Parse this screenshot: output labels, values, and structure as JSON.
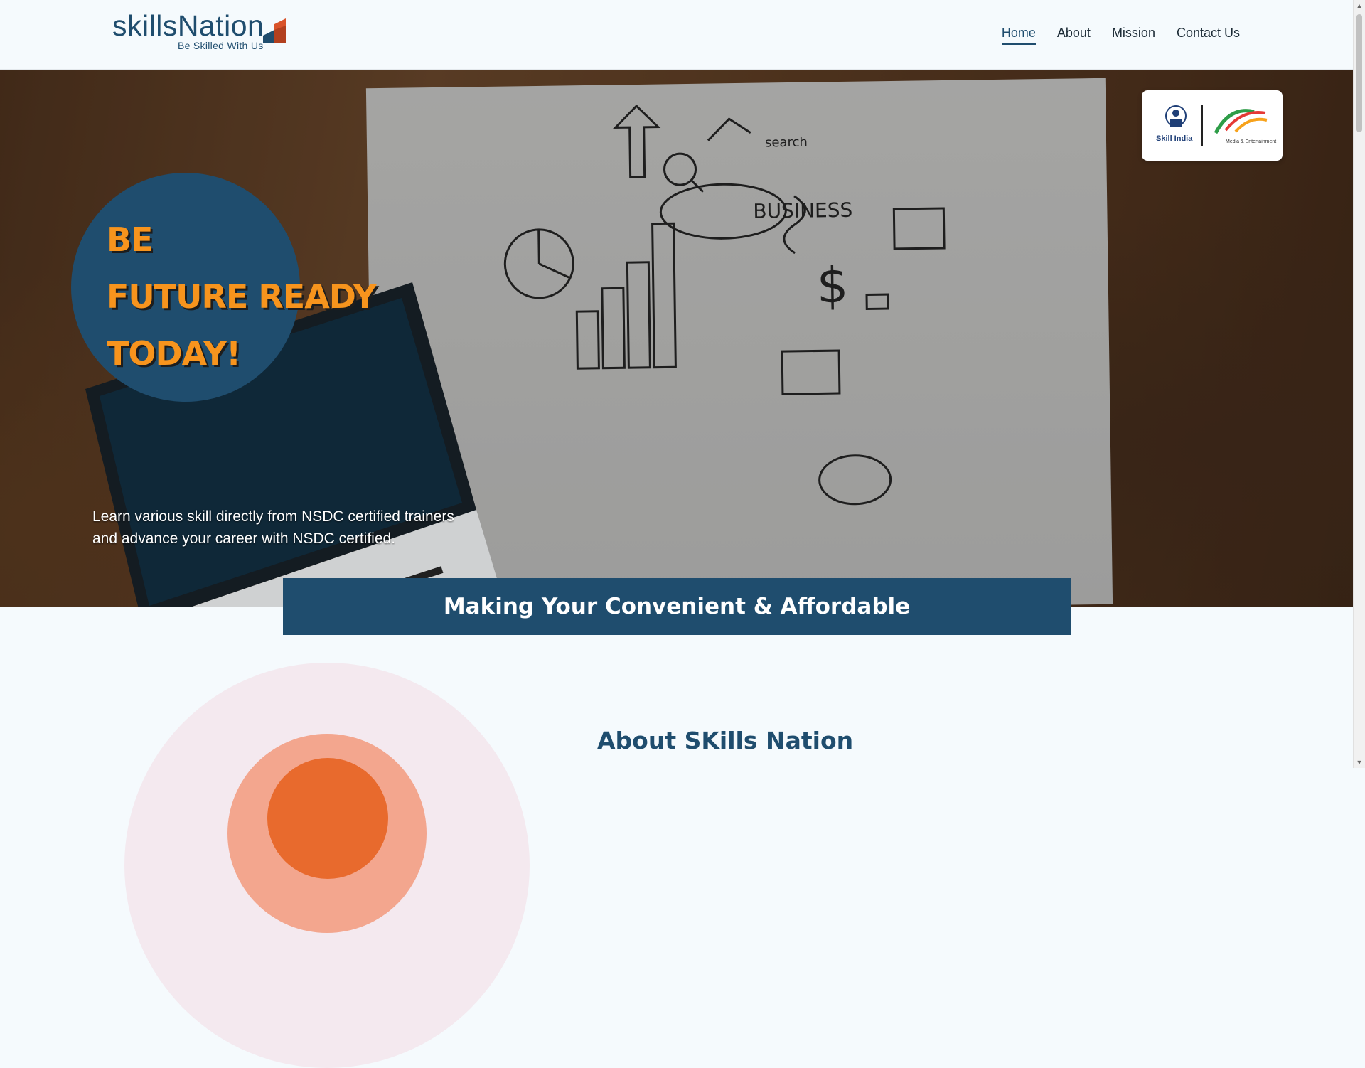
{
  "header": {
    "logo_text": "skillsNation",
    "logo_tagline": "Be Skilled With Us",
    "nav": [
      {
        "label": "Home",
        "active": true
      },
      {
        "label": "About",
        "active": false
      },
      {
        "label": "Mission",
        "active": false
      },
      {
        "label": "Contact Us",
        "active": false
      }
    ]
  },
  "hero": {
    "title_line1": "BE",
    "title_line2": "FUTURE READY",
    "title_line3": "TODAY!",
    "subtitle_line1": "Learn various skill directly from NSDC certified trainers",
    "subtitle_line2": "and advance your career with NSDC certified.",
    "partner_badges": {
      "skill_india": "Skill India",
      "mesc": "Media & Entertainment"
    }
  },
  "banner": {
    "text": "Making Your Convenient & Affordable"
  },
  "about": {
    "title": "About SKills Nation"
  },
  "colors": {
    "primary": "#1f4d6e",
    "accent": "#f7941d",
    "background": "#f5fafd"
  }
}
